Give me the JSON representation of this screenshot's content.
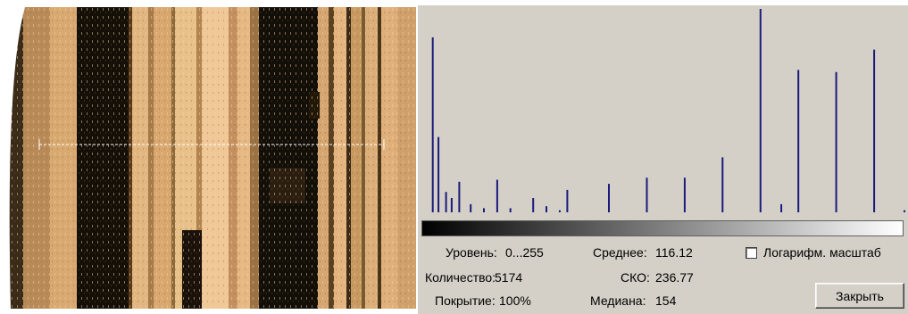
{
  "stats": {
    "level_label": "Уровень:",
    "level_value": "0...255",
    "count_label": "Количество:",
    "count_value": "5174",
    "coverage_label": "Покрытие:",
    "coverage_value": "100%",
    "mean_label": "Среднее:",
    "mean_value": "116.12",
    "std_label": "СКО:",
    "std_value": "236.77",
    "median_label": "Медиана:",
    "median_value": "154"
  },
  "log_scale": {
    "label": "Логарифм. масштаб",
    "checked": false
  },
  "close_button": {
    "label": "Закрыть"
  },
  "histogram": {
    "bar_color": "#1a1a7a",
    "background": "#d4d0c8",
    "x_range": [
      0,
      255
    ],
    "bins": [
      {
        "level": 6,
        "value": 0.86
      },
      {
        "level": 9,
        "value": 0.37
      },
      {
        "level": 13,
        "value": 0.1
      },
      {
        "level": 16,
        "value": 0.07
      },
      {
        "level": 20,
        "value": 0.15
      },
      {
        "level": 26,
        "value": 0.04
      },
      {
        "level": 33,
        "value": 0.02
      },
      {
        "level": 40,
        "value": 0.16
      },
      {
        "level": 47,
        "value": 0.02
      },
      {
        "level": 59,
        "value": 0.07
      },
      {
        "level": 66,
        "value": 0.03
      },
      {
        "level": 73,
        "value": 0.01
      },
      {
        "level": 77,
        "value": 0.11
      },
      {
        "level": 99,
        "value": 0.14
      },
      {
        "level": 119,
        "value": 0.17
      },
      {
        "level": 139,
        "value": 0.17
      },
      {
        "level": 159,
        "value": 0.27
      },
      {
        "level": 179,
        "value": 1.0
      },
      {
        "level": 190,
        "value": 0.04
      },
      {
        "level": 199,
        "value": 0.7
      },
      {
        "level": 219,
        "value": 0.69
      },
      {
        "level": 239,
        "value": 0.8
      },
      {
        "level": 255,
        "value": 0.01
      }
    ]
  },
  "colors": {
    "panel": "#d4d0c8",
    "selection_line": "#ffffff"
  }
}
